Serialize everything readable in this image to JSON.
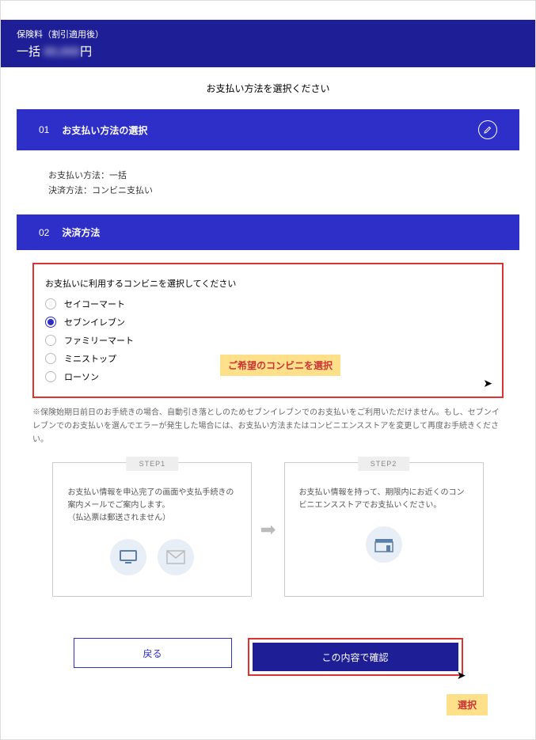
{
  "header": {
    "label": "保険料（割引適用後）",
    "plan": "一括",
    "amount_blur": "00,000",
    "currency": "円"
  },
  "instruction": "お支払い方法を選択ください",
  "section1": {
    "num": "01",
    "title": "お支払い方法の選択",
    "line1": "お支払い方法：一括",
    "line2": "決済方法：コンビニ支払い"
  },
  "section2": {
    "num": "02",
    "title": "決済方法"
  },
  "convenience": {
    "lead": "お支払いに利用するコンビニを選択してください",
    "options": [
      "セイコーマート",
      "セブンイレブン",
      "ファミリーマート",
      "ミニストップ",
      "ローソン"
    ],
    "selected_index": 1
  },
  "annotations": {
    "callout1": "ご希望のコンビニを選択",
    "callout2": "選択"
  },
  "note": "※保険始期日前日のお手続きの場合、自動引き落としのためセブンイレブンでのお支払いをご利用いただけません。もし、セブンイレブンでのお支払いを選んでエラーが発生した場合には、お支払い方法またはコンビニエンスストアを変更して再度お手続きください。",
  "steps": {
    "step1_label": "STEP1",
    "step1_text": "お支払い情報を申込完了の画面や支払手続きの案内メールでご案内します。\n（払込票は郵送されません）",
    "step2_label": "STEP2",
    "step2_text": "お支払い情報を持って、期限内にお近くのコンビニエンスストアでお支払いください。"
  },
  "buttons": {
    "back": "戻る",
    "confirm": "この内容で確認"
  }
}
